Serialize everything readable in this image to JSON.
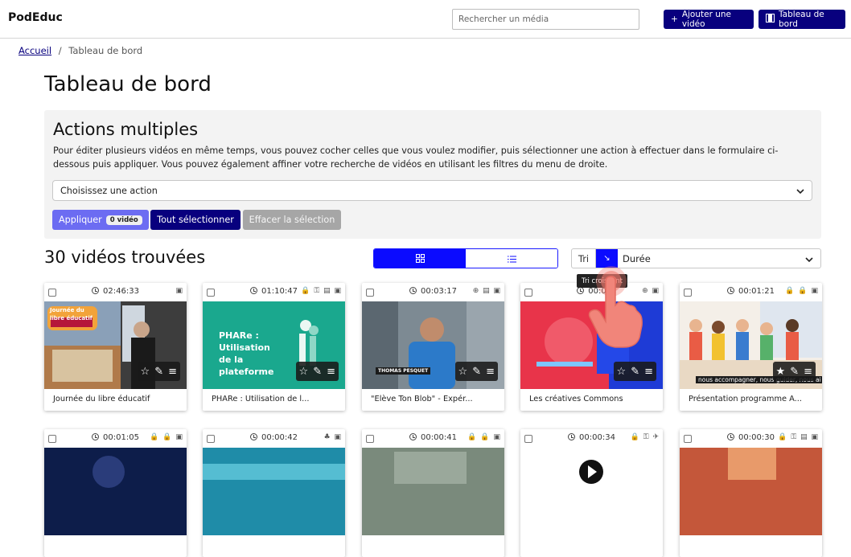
{
  "header": {
    "brand": "PodEduc",
    "search_placeholder": "Rechercher un média",
    "add_video": "Ajouter une vidéo",
    "dashboard": "Tableau de bord"
  },
  "breadcrumb": {
    "home": "Accueil",
    "separator": "/",
    "current": "Tableau de bord"
  },
  "page_title": "Tableau de bord",
  "actions": {
    "title": "Actions multiples",
    "description": "Pour éditer plusieurs vidéos en même temps, vous pouvez cocher celles que vous voulez modifier, puis sélectionner une action à effectuer dans le formulaire ci-dessous puis appliquer. Vous pouvez également affiner votre recherche de vidéos en utilisant les filtres du menu de droite.",
    "select_placeholder": "Choisissez une action",
    "apply": "Appliquer",
    "apply_badge": "0 vidéo",
    "select_all": "Tout sélectionner",
    "clear_selection": "Effacer la sélection"
  },
  "results": {
    "count_label": "30 vidéos trouvées",
    "sort_label": "Tri",
    "sort_field": "Durée",
    "tooltip": "Tri croissant"
  },
  "videos": [
    {
      "duration": "02:46:33",
      "flags": "▣",
      "title": "Journée du libre éducatif",
      "thumb_text": "Journée du libre éducatif"
    },
    {
      "duration": "01:10:47",
      "flags": "🔒 ⚿ ▤ ▣",
      "title": "PHARe : Utilisation de l...",
      "thumb_text": "PHARe : Utilisation de la plateforme"
    },
    {
      "duration": "00:03:17",
      "flags": "⊕ ▤ ▣",
      "title": "\"Elève Ton Blob\" - Expér...",
      "thumb_text": "THOMAS PESQUET"
    },
    {
      "duration": "00:0",
      "flags": "⊕ ▣",
      "title": "Les créatives Commons",
      "thumb_text": ""
    },
    {
      "duration": "00:01:21",
      "flags": "🔒 🔒 ▣",
      "title": "Présentation programme A...",
      "thumb_text": "nous accompagner, nous guider, nous ai"
    },
    {
      "duration": "00:01:05",
      "flags": "🔒 🔒 ▣",
      "title": "",
      "thumb_text": ""
    },
    {
      "duration": "00:00:42",
      "flags": "♣ ▣",
      "title": "",
      "thumb_text": ""
    },
    {
      "duration": "00:00:41",
      "flags": "🔒 🔒 ▣",
      "title": "",
      "thumb_text": ""
    },
    {
      "duration": "00:00:34",
      "flags": "🔒 ⚿ ✈",
      "title": "",
      "thumb_text": ""
    },
    {
      "duration": "00:00:30",
      "flags": "🔒 ⚿ ▤ ▣",
      "title": "",
      "thumb_text": ""
    }
  ],
  "colors": {
    "navy": "#08007e",
    "accent_blue": "#0b0bff",
    "apply": "#6c6cf2",
    "panel": "#f3f3f3"
  }
}
